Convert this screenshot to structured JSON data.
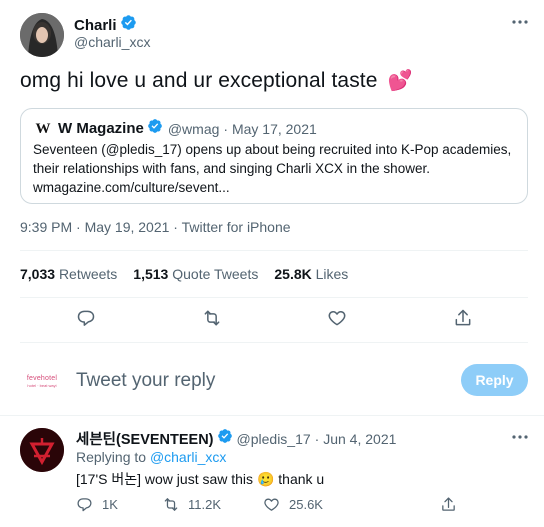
{
  "tweet": {
    "author_name": "Charli",
    "author_handle": "@charli_xcx",
    "text": "omg hi love u and ur exceptional taste",
    "emoji": "💕",
    "timestamp": "9:39 PM · May 19, 2021 · Twitter for iPhone",
    "stats": {
      "retweets_count": "7,033",
      "retweets_label": "Retweets",
      "quotes_count": "1,513",
      "quotes_label": "Quote Tweets",
      "likes_count": "25.8K",
      "likes_label": "Likes"
    }
  },
  "quote": {
    "logo_glyph": "W",
    "author_name": "W Magazine",
    "author_handle": "@wmag",
    "date": "· May 17, 2021",
    "line1": "Seventeen (@pledis_17) opens up about being recruited into K-Pop academies,",
    "line2": "their relationships with fans, and singing Charli XCX in the shower.",
    "line3": "wmagazine.com/culture/sevent..."
  },
  "composer": {
    "avatar_text": "fevehotel",
    "avatar_sub": "hotel · beat wayi",
    "placeholder": "Tweet your reply",
    "button_label": "Reply"
  },
  "reply": {
    "author_name": "세븐틴(SEVENTEEN)",
    "author_handle": "@pledis_17",
    "date": "· Jun 4, 2021",
    "replying_prefix": "Replying to",
    "replying_handle": "@charli_xcx",
    "text_before": "[17'S 버논] wow just saw this",
    "emoji": "🥲",
    "text_after": "thank u",
    "counts": {
      "replies": "1K",
      "retweets": "11.2K",
      "likes": "25.6K"
    }
  },
  "icons": [
    "verified-icon",
    "more-icon",
    "reply-icon",
    "retweet-icon",
    "like-icon",
    "share-icon"
  ],
  "colors": {
    "accent": "#1d9bf0",
    "muted": "#536471",
    "heart": "#f91880",
    "reply_button_disabled": "#8ecdf8"
  }
}
